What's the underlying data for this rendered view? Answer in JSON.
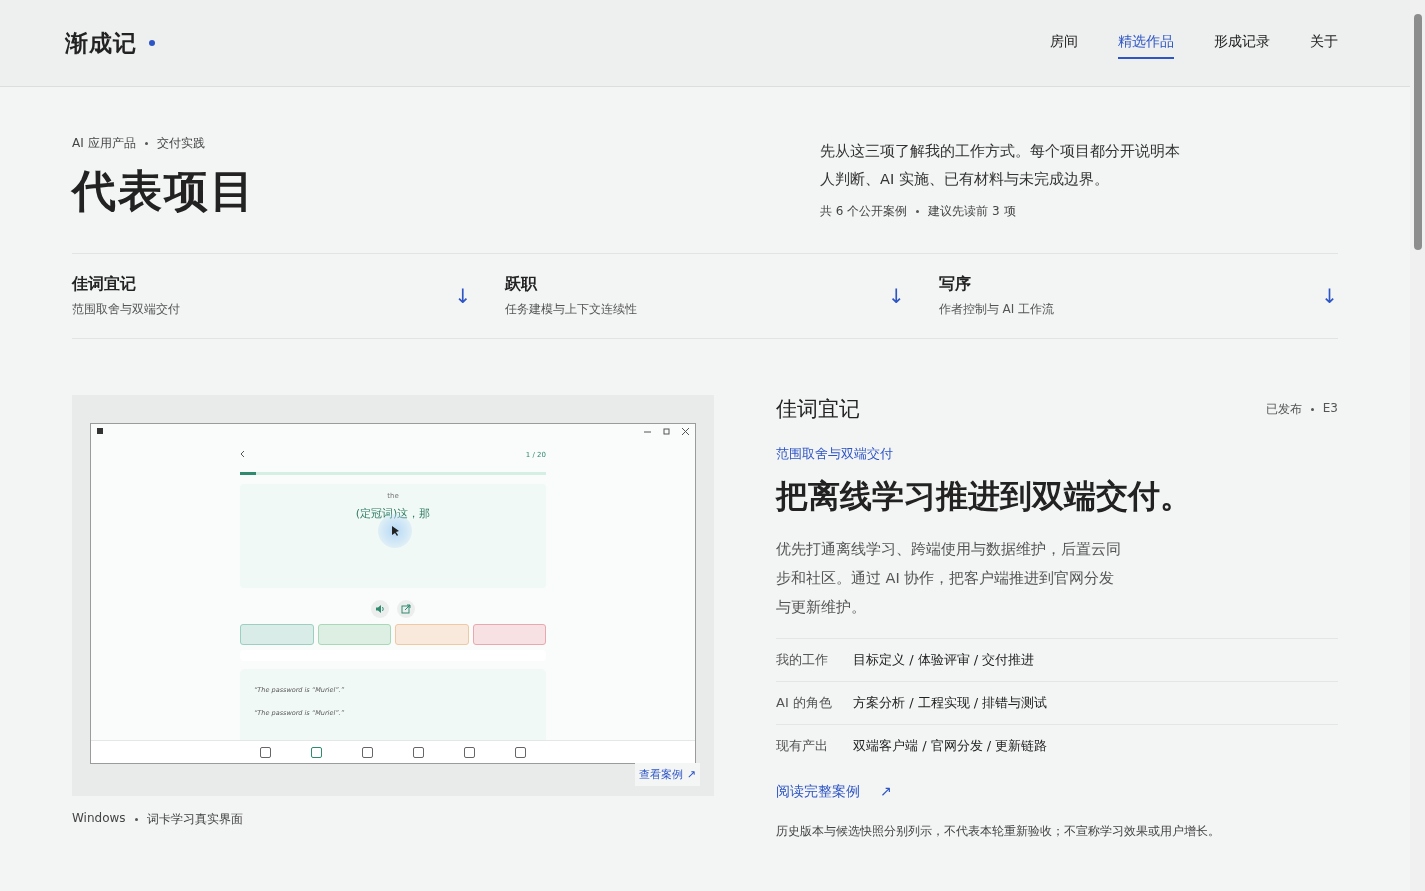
{
  "header": {
    "logo": "渐成记",
    "nav": [
      {
        "label": "房间",
        "selected": false
      },
      {
        "label": "精选作品",
        "selected": true
      },
      {
        "label": "形成记录",
        "selected": false
      },
      {
        "label": "关于",
        "selected": false
      }
    ]
  },
  "intro": {
    "eyebrow": [
      "AI 应用产品",
      "交付实践"
    ],
    "title": "代表项目",
    "description": "先从这三项了解我的工作方式。每个项目都分开说明本人判断、AI 实施、已有材料与未完成边界。",
    "meta": [
      "共 6 个公开案例",
      "建议先读前 3 项"
    ]
  },
  "jump_links": [
    {
      "title": "佳词宜记",
      "subtitle": "范围取舍与双端交付",
      "arrow": "↓"
    },
    {
      "title": "跃职",
      "subtitle": "任务建模与上下文连续性",
      "arrow": "↓"
    },
    {
      "title": "写序",
      "subtitle": "作者控制与 AI 工作流",
      "arrow": "↓"
    }
  ],
  "project": {
    "screenshot": {
      "progress": "1 / 20",
      "word": "the",
      "meaning": "(定冠词)这，那",
      "examples": [
        "“The password is “Muriel”.”",
        "“The password is “Muriel”.”"
      ],
      "answer_buttons": [
        {
          "color": "#d9ece8"
        },
        {
          "color": "#dcefe2"
        },
        {
          "color": "#f8e9dc"
        },
        {
          "color": "#f8e1e3"
        }
      ],
      "view_link": "查看案例 ↗"
    },
    "caption": [
      "Windows",
      "词卡学习真实界面"
    ],
    "name": "佳词宜记",
    "status": [
      "已发布",
      "E3"
    ],
    "subtitle": "范围取舍与双端交付",
    "headline": "把离线学习推进到双端交付。",
    "summary": "优先打通离线学习、跨端使用与数据维护，后置云同步和社区。通过 AI 协作，把客户端推进到官网分发与更新维护。",
    "facts": [
      {
        "label": "我的工作",
        "value": "目标定义 / 体验评审 / 交付推进"
      },
      {
        "label": "AI 的角色",
        "value": "方案分析 / 工程实现 / 排错与测试"
      },
      {
        "label": "现有产出",
        "value": "双端客户端 / 官网分发 / 更新链路"
      }
    ],
    "read_link": "阅读完整案例",
    "read_arrow": "↗",
    "note": "历史版本与候选快照分别列示，不代表本轮重新验收；不宣称学习效果或用户增长。"
  }
}
